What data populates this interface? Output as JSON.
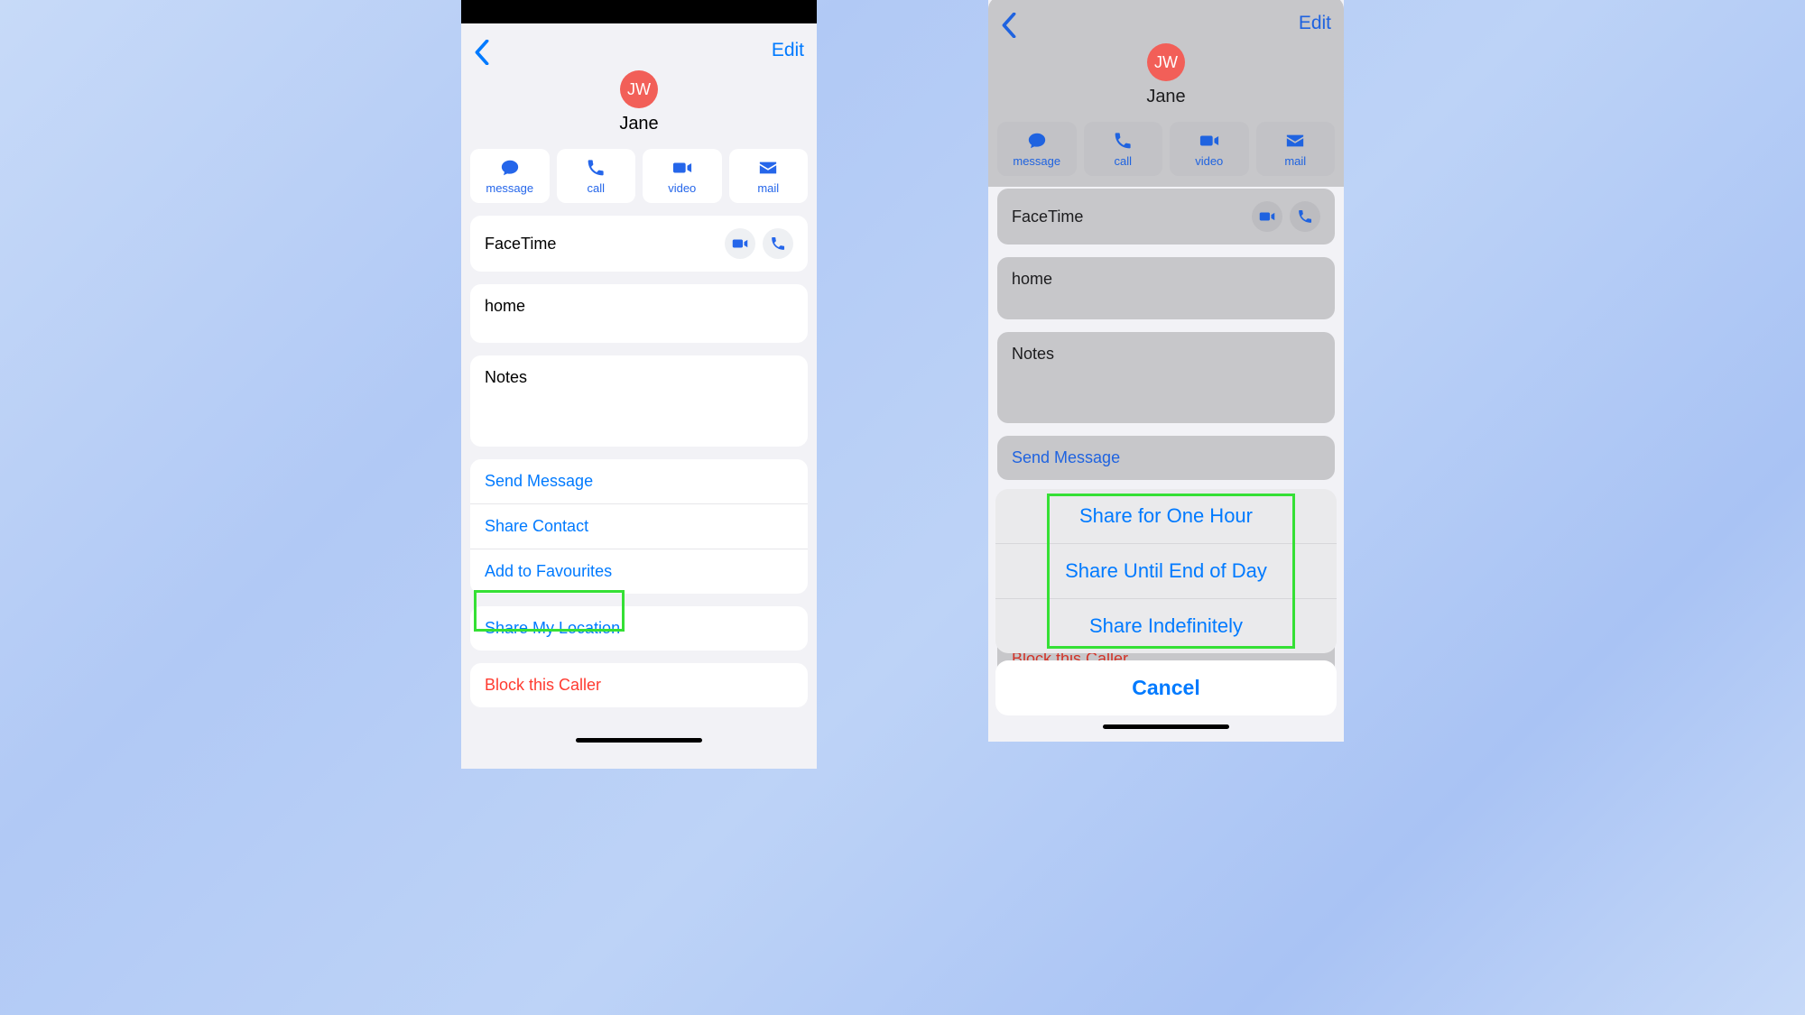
{
  "nav": {
    "edit": "Edit",
    "back": "‹"
  },
  "contact": {
    "initials": "JW",
    "name": "Jane"
  },
  "actions": {
    "message": "message",
    "call": "call",
    "video": "video",
    "mail": "mail"
  },
  "rows": {
    "facetime": "FaceTime",
    "home": "home",
    "notes": "Notes",
    "send_message": "Send Message",
    "share_contact": "Share Contact",
    "add_favourites": "Add to Favourites",
    "share_location": "Share My Location",
    "block": "Block this Caller"
  },
  "sheet": {
    "option1": "Share for One Hour",
    "option2": "Share Until End of Day",
    "option3": "Share Indefinitely",
    "cancel": "Cancel"
  }
}
